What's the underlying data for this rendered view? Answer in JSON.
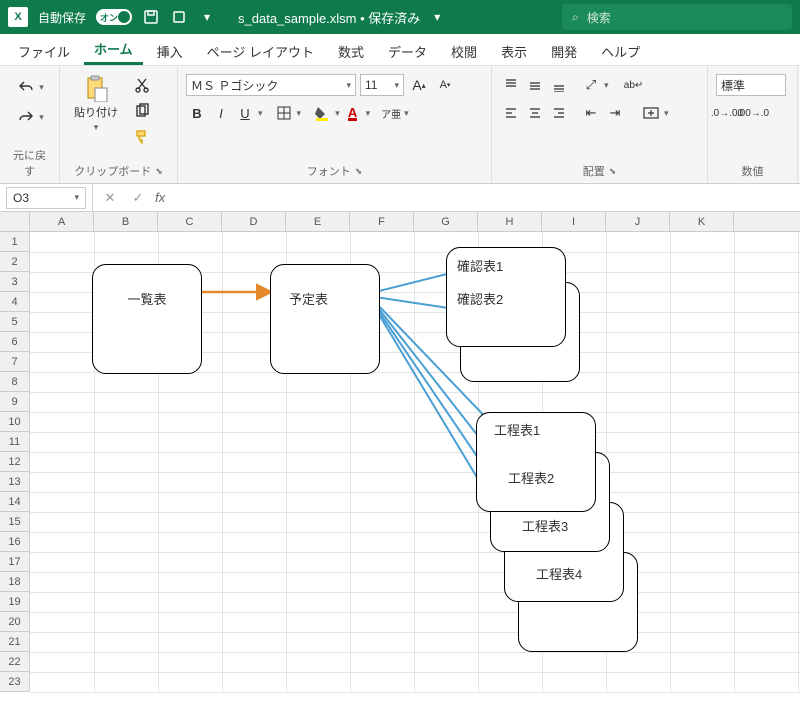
{
  "titlebar": {
    "autosave_label": "自動保存",
    "toggle_text": "オン",
    "filename": "s_data_sample.xlsm • 保存済み",
    "search_placeholder": "検索"
  },
  "tabs": {
    "file": "ファイル",
    "home": "ホーム",
    "insert": "挿入",
    "layout": "ページ レイアウト",
    "formula": "数式",
    "data": "データ",
    "review": "校閲",
    "view": "表示",
    "dev": "開発",
    "help": "ヘルプ"
  },
  "ribbon": {
    "undo_label": "元に戻す",
    "clipboard": {
      "paste": "貼り付け",
      "label": "クリップボード"
    },
    "font": {
      "name": "ＭＳ Ｐゴシック",
      "size": "11",
      "label": "フォント",
      "ruby": "ア亜"
    },
    "align": {
      "label": "配置",
      "wrap": "ab"
    },
    "number": {
      "style": "標準",
      "label": "数値"
    }
  },
  "formulabar": {
    "cell": "O3"
  },
  "columns": [
    "A",
    "B",
    "C",
    "D",
    "E",
    "F",
    "G",
    "H",
    "I",
    "J",
    "K"
  ],
  "rows": [
    "1",
    "2",
    "3",
    "4",
    "5",
    "6",
    "7",
    "8",
    "9",
    "10",
    "11",
    "12",
    "13",
    "14",
    "15",
    "16",
    "17",
    "18",
    "19",
    "20",
    "21",
    "22",
    "23"
  ],
  "shapes": {
    "list": "一覧表",
    "sched": "予定表",
    "chk1": "確認表1",
    "chk2": "確認表2",
    "p1": "工程表1",
    "p2": "工程表2",
    "p3": "工程表3",
    "p4": "工程表4"
  }
}
